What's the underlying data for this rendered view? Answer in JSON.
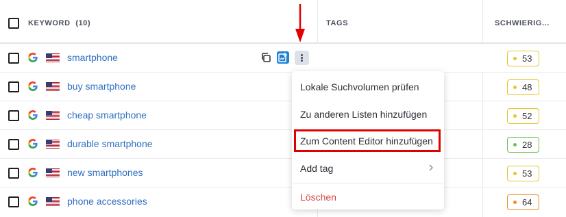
{
  "header": {
    "keyword_label": "KEYWORD",
    "keyword_count": "(10)",
    "tags_label": "TAGS",
    "difficulty_label": "SCHWIERIG..."
  },
  "rows": [
    {
      "keyword": "smartphone",
      "difficulty": "53",
      "level": "yellow"
    },
    {
      "keyword": "buy smartphone",
      "difficulty": "48",
      "level": "yellow"
    },
    {
      "keyword": "cheap smartphone",
      "difficulty": "52",
      "level": "yellow"
    },
    {
      "keyword": "durable smartphone",
      "difficulty": "28",
      "level": "green"
    },
    {
      "keyword": "new smartphones",
      "difficulty": "53",
      "level": "yellow"
    },
    {
      "keyword": "phone accessories",
      "difficulty": "64",
      "level": "orange"
    }
  ],
  "context_menu": {
    "items": [
      "Lokale Suchvolumen prüfen",
      "Zu anderen Listen hinzufügen",
      "Zum Content Editor hinzufügen",
      "Add tag",
      "Löschen"
    ]
  },
  "colors": {
    "link": "#2d6fc1",
    "highlight": "#e00000",
    "arrow": "#e00000",
    "danger": "#d64545"
  }
}
